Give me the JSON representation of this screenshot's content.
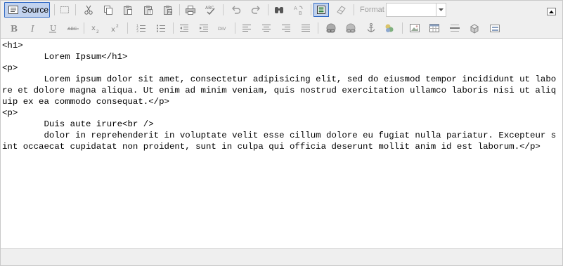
{
  "toolbar1": {
    "source_label": "Source",
    "format_label": "Format",
    "format_value": "",
    "buttons": [
      {
        "name": "source-icon"
      },
      {
        "name": "select-all-icon"
      },
      {
        "name": "cut-icon"
      },
      {
        "name": "copy-icon"
      },
      {
        "name": "paste-icon"
      },
      {
        "name": "paste-text-icon"
      },
      {
        "name": "paste-word-icon"
      },
      {
        "name": "print-icon"
      },
      {
        "name": "spellcheck-icon"
      },
      {
        "name": "undo-icon"
      },
      {
        "name": "redo-icon"
      },
      {
        "name": "find-icon"
      },
      {
        "name": "replace-icon"
      },
      {
        "name": "maximize-icon"
      },
      {
        "name": "remove-format-icon"
      }
    ]
  },
  "toolbar2": {
    "buttons": [
      {
        "name": "bold-icon",
        "glyph": "B"
      },
      {
        "name": "italic-icon",
        "glyph": "I"
      },
      {
        "name": "underline-icon",
        "glyph": "U"
      },
      {
        "name": "strikethrough-icon",
        "glyph": "ABC"
      },
      {
        "name": "subscript-icon",
        "glyph": "x₂"
      },
      {
        "name": "superscript-icon",
        "glyph": "x²"
      },
      {
        "name": "numbered-list-icon"
      },
      {
        "name": "bulleted-list-icon"
      },
      {
        "name": "outdent-icon"
      },
      {
        "name": "indent-icon"
      },
      {
        "name": "div-container-icon",
        "glyph": "DIV"
      },
      {
        "name": "align-left-icon"
      },
      {
        "name": "align-center-icon"
      },
      {
        "name": "align-right-icon"
      },
      {
        "name": "align-justify-icon"
      },
      {
        "name": "link-icon"
      },
      {
        "name": "unlink-icon"
      },
      {
        "name": "anchor-icon"
      },
      {
        "name": "internal-link-icon"
      },
      {
        "name": "image-icon"
      },
      {
        "name": "table-icon"
      },
      {
        "name": "horizontal-rule-icon"
      },
      {
        "name": "special-char-icon"
      },
      {
        "name": "template-icon"
      }
    ]
  },
  "editor": {
    "source_code": "<h1>\n\tLorem Ipsum</h1>\n<p>\n\tLorem ipsum dolor sit amet, consectetur adipisicing elit, sed do eiusmod tempor incididunt ut labore et dolore magna aliqua. Ut enim ad minim veniam, quis nostrud exercitation ullamco laboris nisi ut aliquip ex ea commodo consequat.</p>\n<p>\n\tDuis aute irure<br />\n\tdolor in reprehenderit in voluptate velit esse cillum dolore eu fugiat nulla pariatur. Excepteur sint occaecat cupidatat non proident, sunt in culpa qui officia deserunt mollit anim id est laborum.</p>"
  },
  "colors": {
    "toolbar_bg": "#efefef",
    "active_button_bg": "#c1d2ee",
    "active_button_border": "#316ac5",
    "border": "#c9c9c9"
  }
}
